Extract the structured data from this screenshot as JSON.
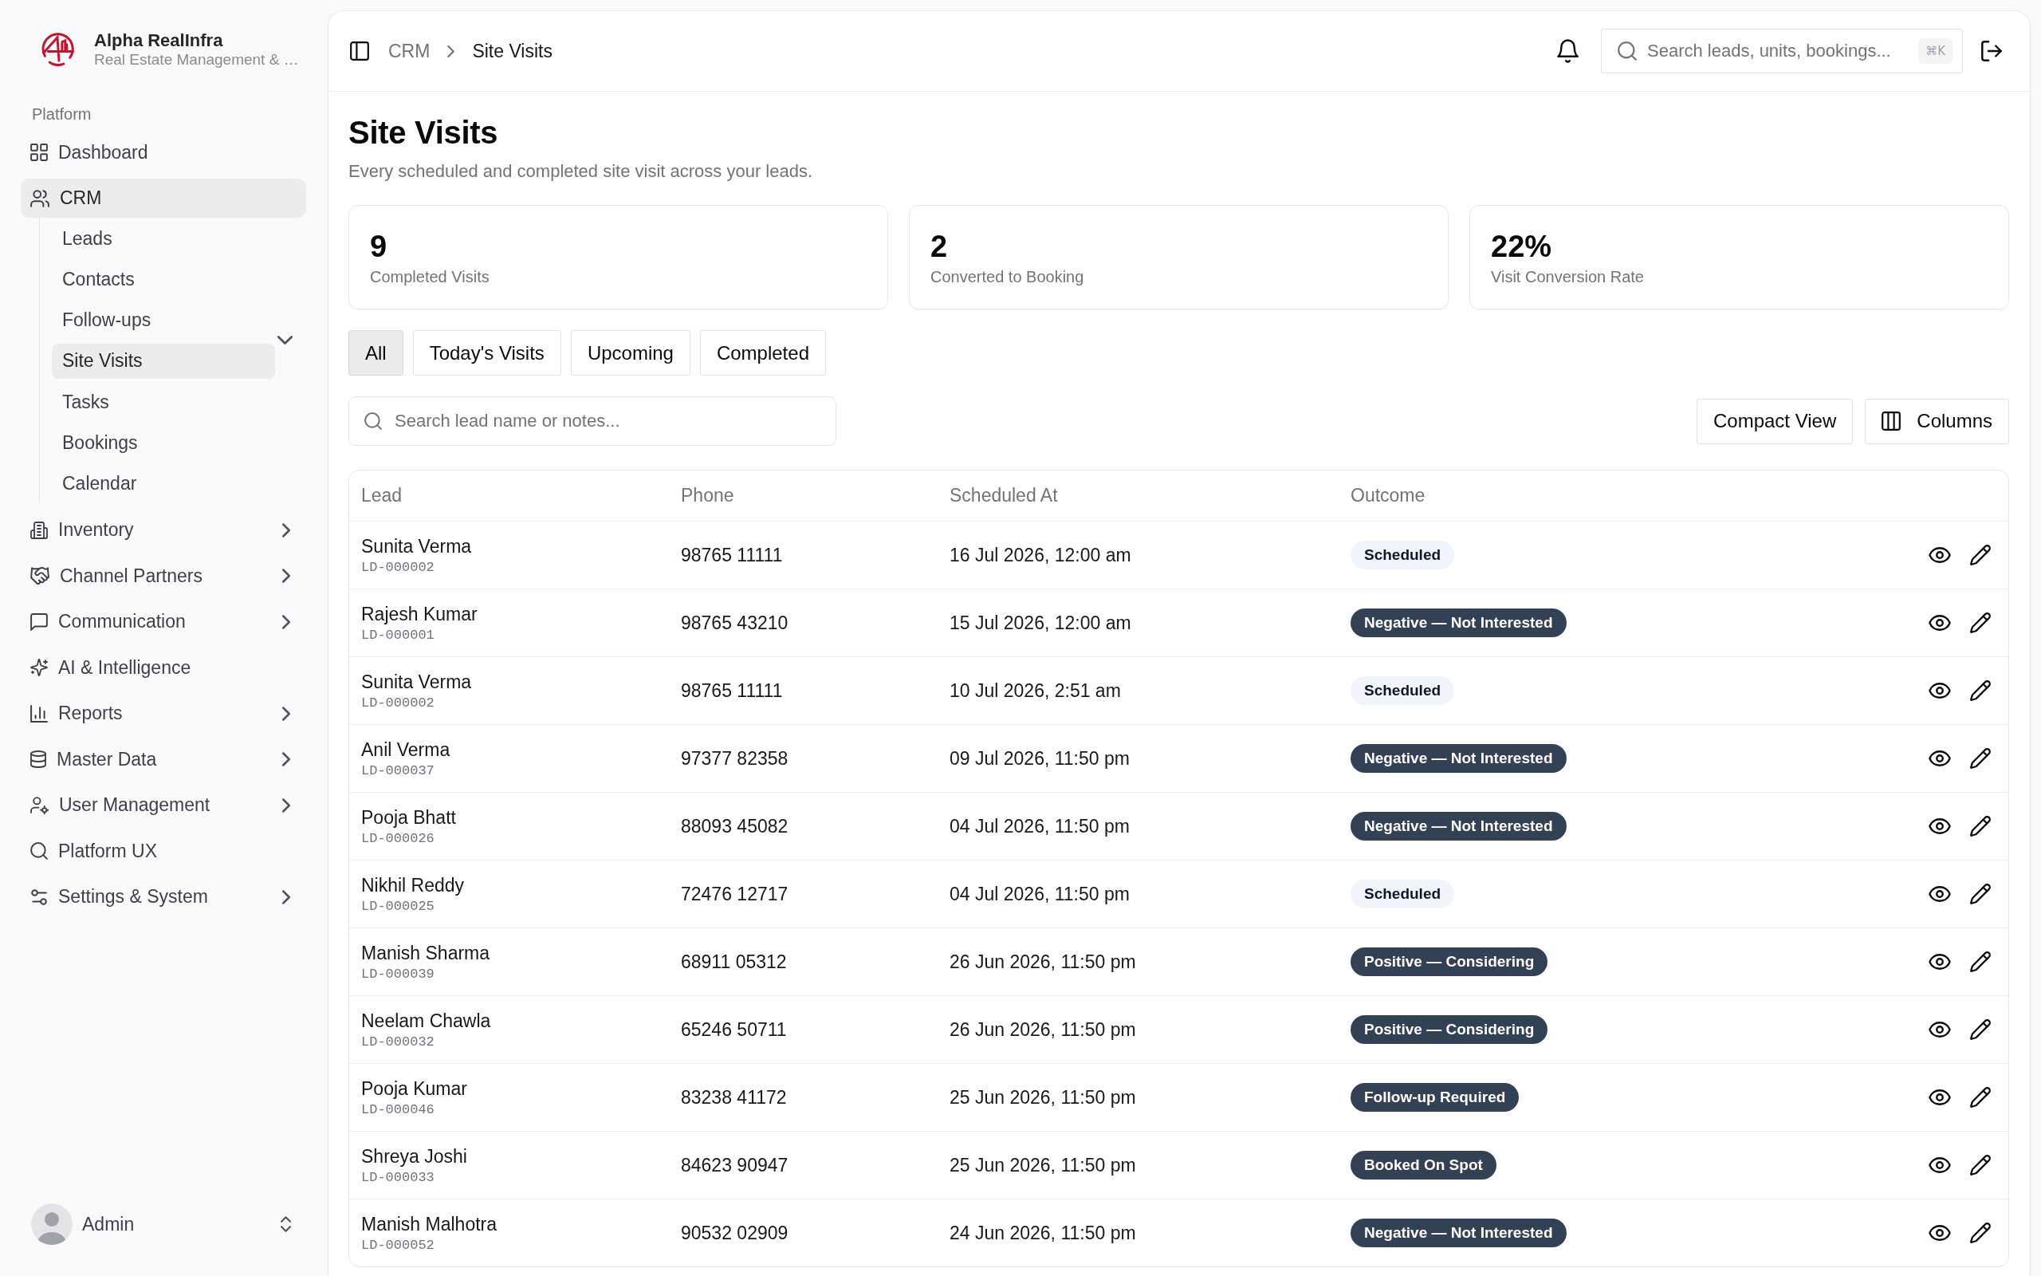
{
  "sidebar": {
    "brand": {
      "name": "Alpha RealInfra",
      "tagline": "Real Estate Management & …"
    },
    "section_label": "Platform",
    "items": [
      {
        "label": "Dashboard",
        "kind": "link",
        "selected": false
      },
      {
        "label": "CRM",
        "kind": "group",
        "selected": true,
        "expanded": true,
        "children": [
          {
            "label": "Leads",
            "selected": false
          },
          {
            "label": "Contacts",
            "selected": false
          },
          {
            "label": "Follow-ups",
            "selected": false
          },
          {
            "label": "Site Visits",
            "selected": true
          },
          {
            "label": "Tasks",
            "selected": false
          },
          {
            "label": "Bookings",
            "selected": false
          },
          {
            "label": "Calendar",
            "selected": false
          }
        ]
      },
      {
        "label": "Inventory",
        "kind": "group",
        "selected": false,
        "expanded": false
      },
      {
        "label": "Channel Partners",
        "kind": "group",
        "selected": false,
        "expanded": false
      },
      {
        "label": "Communication",
        "kind": "group",
        "selected": false,
        "expanded": false
      },
      {
        "label": "AI & Intelligence",
        "kind": "link",
        "selected": false
      },
      {
        "label": "Reports",
        "kind": "group",
        "selected": false,
        "expanded": false
      },
      {
        "label": "Master Data",
        "kind": "group",
        "selected": false,
        "expanded": false
      },
      {
        "label": "User Management",
        "kind": "group",
        "selected": false,
        "expanded": false
      },
      {
        "label": "Platform UX",
        "kind": "link",
        "selected": false
      },
      {
        "label": "Settings & System",
        "kind": "group",
        "selected": false,
        "expanded": false
      }
    ],
    "user": {
      "name": "Admin"
    }
  },
  "header": {
    "breadcrumb": [
      {
        "label": "CRM",
        "current": false
      },
      {
        "label": "Site Visits",
        "current": true
      }
    ],
    "search": {
      "placeholder": "Search leads, units, bookings...",
      "shortcut": "⌘K"
    }
  },
  "page": {
    "title": "Site Visits",
    "subtitle": "Every scheduled and completed site visit across your leads."
  },
  "stats": [
    {
      "value": "9",
      "label": "Completed Visits"
    },
    {
      "value": "2",
      "label": "Converted to Booking"
    },
    {
      "value": "22%",
      "label": "Visit Conversion Rate"
    }
  ],
  "filters": [
    {
      "label": "All",
      "selected": true
    },
    {
      "label": "Today's Visits",
      "selected": false
    },
    {
      "label": "Upcoming",
      "selected": false
    },
    {
      "label": "Completed",
      "selected": false
    }
  ],
  "search": {
    "placeholder": "Search lead name or notes..."
  },
  "toolbar": [
    {
      "label": "Compact View",
      "kind": "text"
    },
    {
      "label": "Columns",
      "kind": "columns"
    }
  ],
  "table": {
    "columns": [
      "Lead",
      "Phone",
      "Scheduled At",
      "Outcome"
    ],
    "rows": [
      {
        "lead": "Sunita Verma",
        "lead_id": "LD-000002",
        "phone": "98765 11111",
        "scheduled_at": "16 Jul 2026, 12:00 am",
        "outcome": {
          "label": "Scheduled",
          "kind": "muted"
        }
      },
      {
        "lead": "Rajesh Kumar",
        "lead_id": "LD-000001",
        "phone": "98765 43210",
        "scheduled_at": "15 Jul 2026, 12:00 am",
        "outcome": {
          "label": "Negative — Not Interested",
          "kind": "solid"
        }
      },
      {
        "lead": "Sunita Verma",
        "lead_id": "LD-000002",
        "phone": "98765 11111",
        "scheduled_at": "10 Jul 2026, 2:51 am",
        "outcome": {
          "label": "Scheduled",
          "kind": "muted"
        }
      },
      {
        "lead": "Anil Verma",
        "lead_id": "LD-000037",
        "phone": "97377 82358",
        "scheduled_at": "09 Jul 2026, 11:50 pm",
        "outcome": {
          "label": "Negative — Not Interested",
          "kind": "solid"
        }
      },
      {
        "lead": "Pooja Bhatt",
        "lead_id": "LD-000026",
        "phone": "88093 45082",
        "scheduled_at": "04 Jul 2026, 11:50 pm",
        "outcome": {
          "label": "Negative — Not Interested",
          "kind": "solid"
        }
      },
      {
        "lead": "Nikhil Reddy",
        "lead_id": "LD-000025",
        "phone": "72476 12717",
        "scheduled_at": "04 Jul 2026, 11:50 pm",
        "outcome": {
          "label": "Scheduled",
          "kind": "muted"
        }
      },
      {
        "lead": "Manish Sharma",
        "lead_id": "LD-000039",
        "phone": "68911 05312",
        "scheduled_at": "26 Jun 2026, 11:50 pm",
        "outcome": {
          "label": "Positive — Considering",
          "kind": "solid"
        }
      },
      {
        "lead": "Neelam Chawla",
        "lead_id": "LD-000032",
        "phone": "65246 50711",
        "scheduled_at": "26 Jun 2026, 11:50 pm",
        "outcome": {
          "label": "Positive — Considering",
          "kind": "solid"
        }
      },
      {
        "lead": "Pooja Kumar",
        "lead_id": "LD-000046",
        "phone": "83238 41172",
        "scheduled_at": "25 Jun 2026, 11:50 pm",
        "outcome": {
          "label": "Follow-up Required",
          "kind": "solid"
        }
      },
      {
        "lead": "Shreya Joshi",
        "lead_id": "LD-000033",
        "phone": "84623 90947",
        "scheduled_at": "25 Jun 2026, 11:50 pm",
        "outcome": {
          "label": "Booked On Spot",
          "kind": "solid"
        }
      },
      {
        "lead": "Manish Malhotra",
        "lead_id": "LD-000052",
        "phone": "90532 02909",
        "scheduled_at": "24 Jun 2026, 11:50 pm",
        "outcome": {
          "label": "Negative — Not Interested",
          "kind": "solid"
        }
      }
    ]
  }
}
